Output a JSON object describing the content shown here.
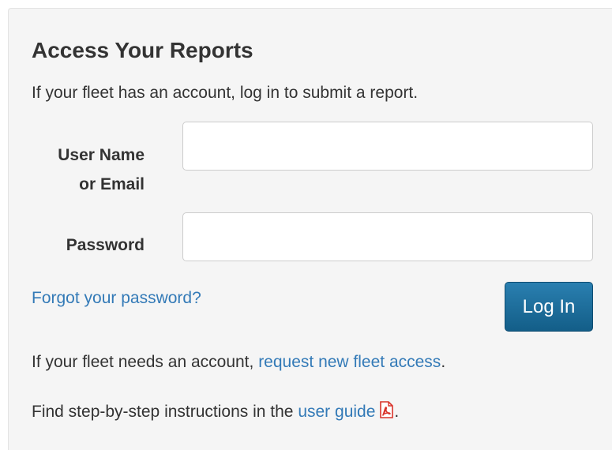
{
  "login": {
    "title": "Access Your Reports",
    "intro": "If your fleet has an account, log in to submit a report.",
    "username_label_line1": "User Name",
    "username_label_line2": "or Email",
    "username_value": "",
    "password_label": "Password",
    "password_value": "",
    "forgot_link": "Forgot your password?",
    "login_button": "Log In",
    "need_account_text": "If your fleet needs an account, ",
    "request_access_link": "request new fleet access",
    "need_account_suffix": ".",
    "guide_text": "Find step-by-step instructions in the ",
    "guide_link": "user guide",
    "guide_suffix": ".",
    "guide_icon": "pdf-icon"
  },
  "colors": {
    "panel_background": "#f5f5f5",
    "link": "#337ab7",
    "button": "#1f6d99",
    "pdf_icon": "#d9342b"
  }
}
